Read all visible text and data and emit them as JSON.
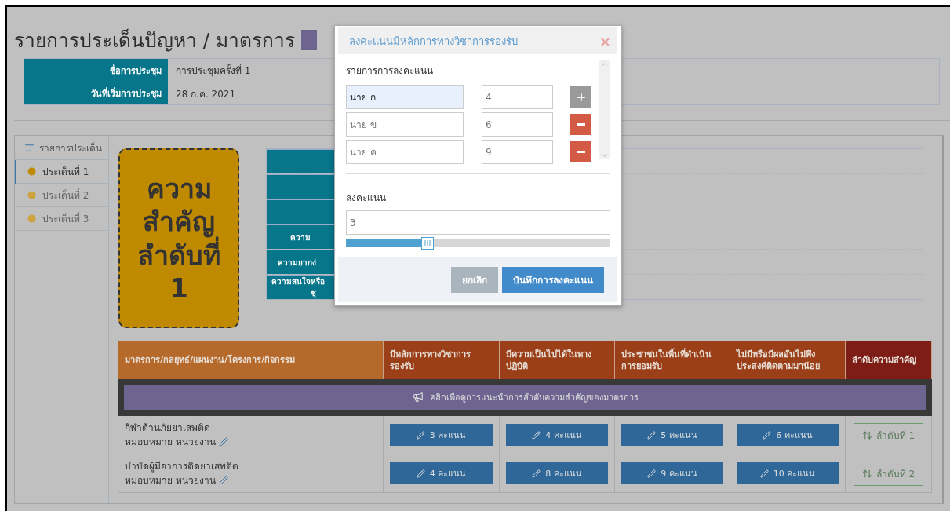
{
  "page_title": "รายการประเด็นปัญหา / มาตรการ",
  "meeting_info": [
    {
      "label": "ชื่อการประชุม",
      "value": "การประชุมครั้งที่ 1"
    },
    {
      "label": "วันที่เริ่มการประชุม",
      "value": "28 ก.ค. 2021"
    }
  ],
  "sidebar": {
    "header": "รายการประเด็น",
    "items": [
      {
        "label": "ประเด็นที่ 1",
        "selected": true
      },
      {
        "label": "ประเด็นที่ 2",
        "selected": false
      },
      {
        "label": "ประเด็นที่ 3",
        "selected": false
      }
    ]
  },
  "priority_card": {
    "text": "ความสำคัญลำดับที่",
    "rank": "1"
  },
  "criteria_rows": [
    {
      "covered": true
    },
    {
      "covered": true
    },
    {
      "covered": true
    },
    {
      "covered": false,
      "lines": [
        "ความ"
      ]
    },
    {
      "covered": false,
      "lines": [
        "ความยากง่"
      ]
    },
    {
      "covered": false,
      "lines": [
        "ความสนใจหรือ",
        "ชุ"
      ]
    }
  ],
  "measures_table": {
    "columns": [
      "มาตรการ/กลยุทธ์/แผนงาน/โครงการ/กิจกรรม",
      "มีหลักการทางวิชาการรองรับ",
      "มีความเป็นไปได้ในทางปฏิบัติ",
      "ประชาชนในพื้นที่ดำเนินการยอมรับ",
      "ไม่มีหรือมีผลอันไม่พึงประสงค์ติดตามมาน้อย",
      "ลำดับความสำคัญ"
    ],
    "banner": "คลิกเพื่อดูการแนะนำการลำดับความสำคัญของมาตรการ",
    "rows": [
      {
        "name": "กีฬาต้านภัยยาเสพติด",
        "assignee": "หมอบหมาย หน่วยงาน",
        "scores": [
          "3 คะแนน",
          "4 คะแนน",
          "5 คะแนน",
          "6 คะแนน"
        ],
        "rank": "ลำดับที่ 1"
      },
      {
        "name": "บำบัดผู้มีอาการติดยาเสพติด",
        "assignee": "หมอบหมาย หน่วยงาน",
        "scores": [
          "4 คะแนน",
          "8 คะแนน",
          "9 คะแนน",
          "10 คะแนน"
        ],
        "rank": "ลำดับที่ 2"
      }
    ]
  },
  "dialog": {
    "title": "ลงคะแนนมีหลักการทางวิชาการรองรับ",
    "close": "×",
    "list_label": "รายการการลงคะแนน",
    "voters": [
      {
        "name": "นาย ก",
        "score": "4",
        "autofilled": true,
        "kind": "add"
      },
      {
        "name": "นาย ข",
        "score": "6",
        "autofilled": false,
        "kind": "remove"
      },
      {
        "name": "นาย ค",
        "score": "9",
        "autofilled": false,
        "kind": "remove"
      }
    ],
    "score_label": "ลงคะแนน",
    "score_value": "3",
    "level": 0.31,
    "buttons": [
      "ยกเลิก",
      "บันทึกการลงคะแนน"
    ]
  }
}
